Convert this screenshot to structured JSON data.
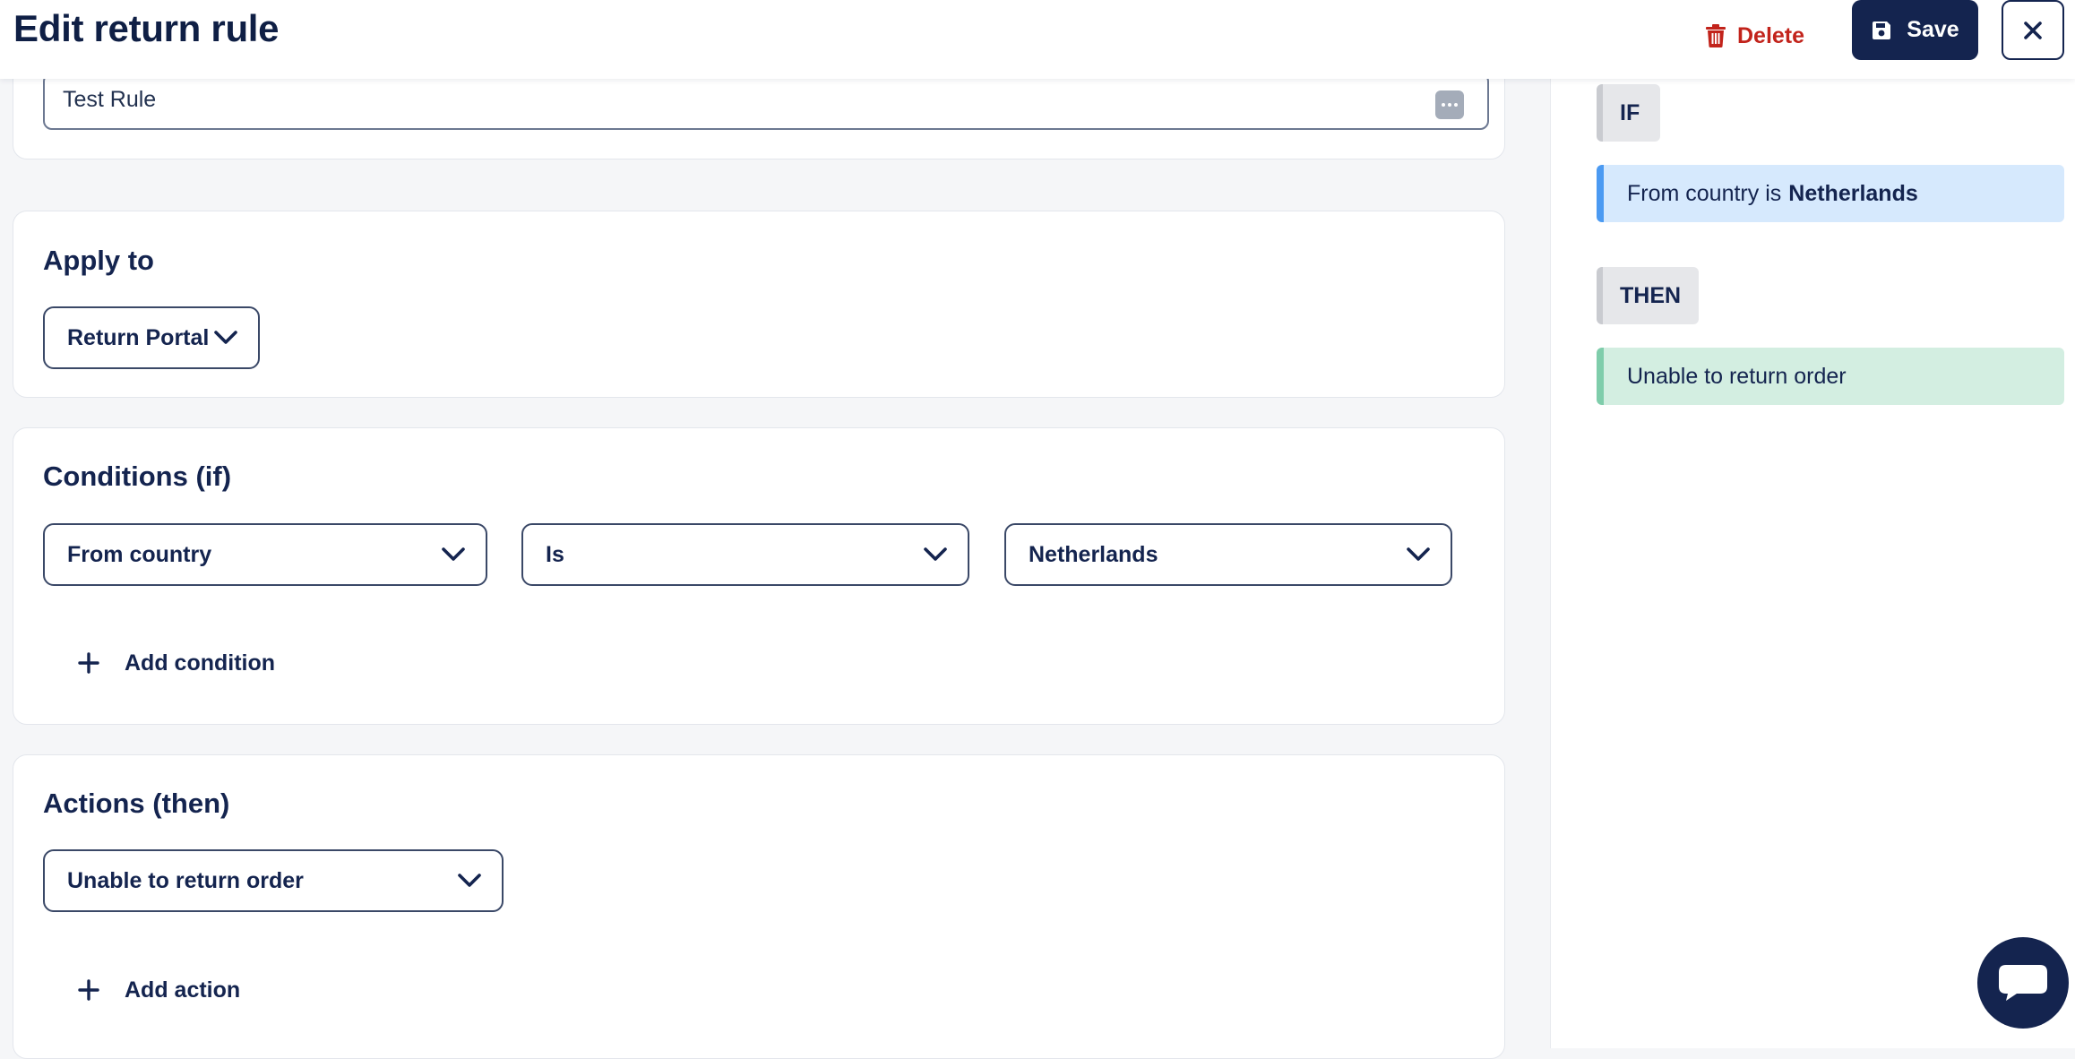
{
  "header": {
    "title": "Edit return rule",
    "delete_label": "Delete",
    "save_label": "Save"
  },
  "name_section": {
    "value": "Test Rule"
  },
  "apply_section": {
    "heading": "Apply to",
    "selected": "Return Portal"
  },
  "conditions_section": {
    "heading": "Conditions (if)",
    "field": "From country",
    "operator": "Is",
    "value": "Netherlands",
    "add_label": "Add condition"
  },
  "actions_section": {
    "heading": "Actions (then)",
    "selected": "Unable to return order",
    "add_label": "Add action"
  },
  "summary": {
    "if_tag": "IF",
    "if_text": "From country is",
    "if_value": "Netherlands",
    "then_tag": "THEN",
    "then_text": "Unable to return order"
  },
  "colors": {
    "primary": "#14244f",
    "danger": "#c2231b",
    "if_bg": "#d6e9fd",
    "if_border": "#4b9af2",
    "then_bg": "#d3eee1",
    "then_border": "#7fcdab"
  },
  "icons": {
    "delete": "trash-icon",
    "save": "floppy-disk-icon",
    "close": "close-icon",
    "dropdown": "chevron-down-icon",
    "add": "plus-icon",
    "chat": "chat-bubble-icon",
    "password_manager": "more-dots-icon"
  }
}
